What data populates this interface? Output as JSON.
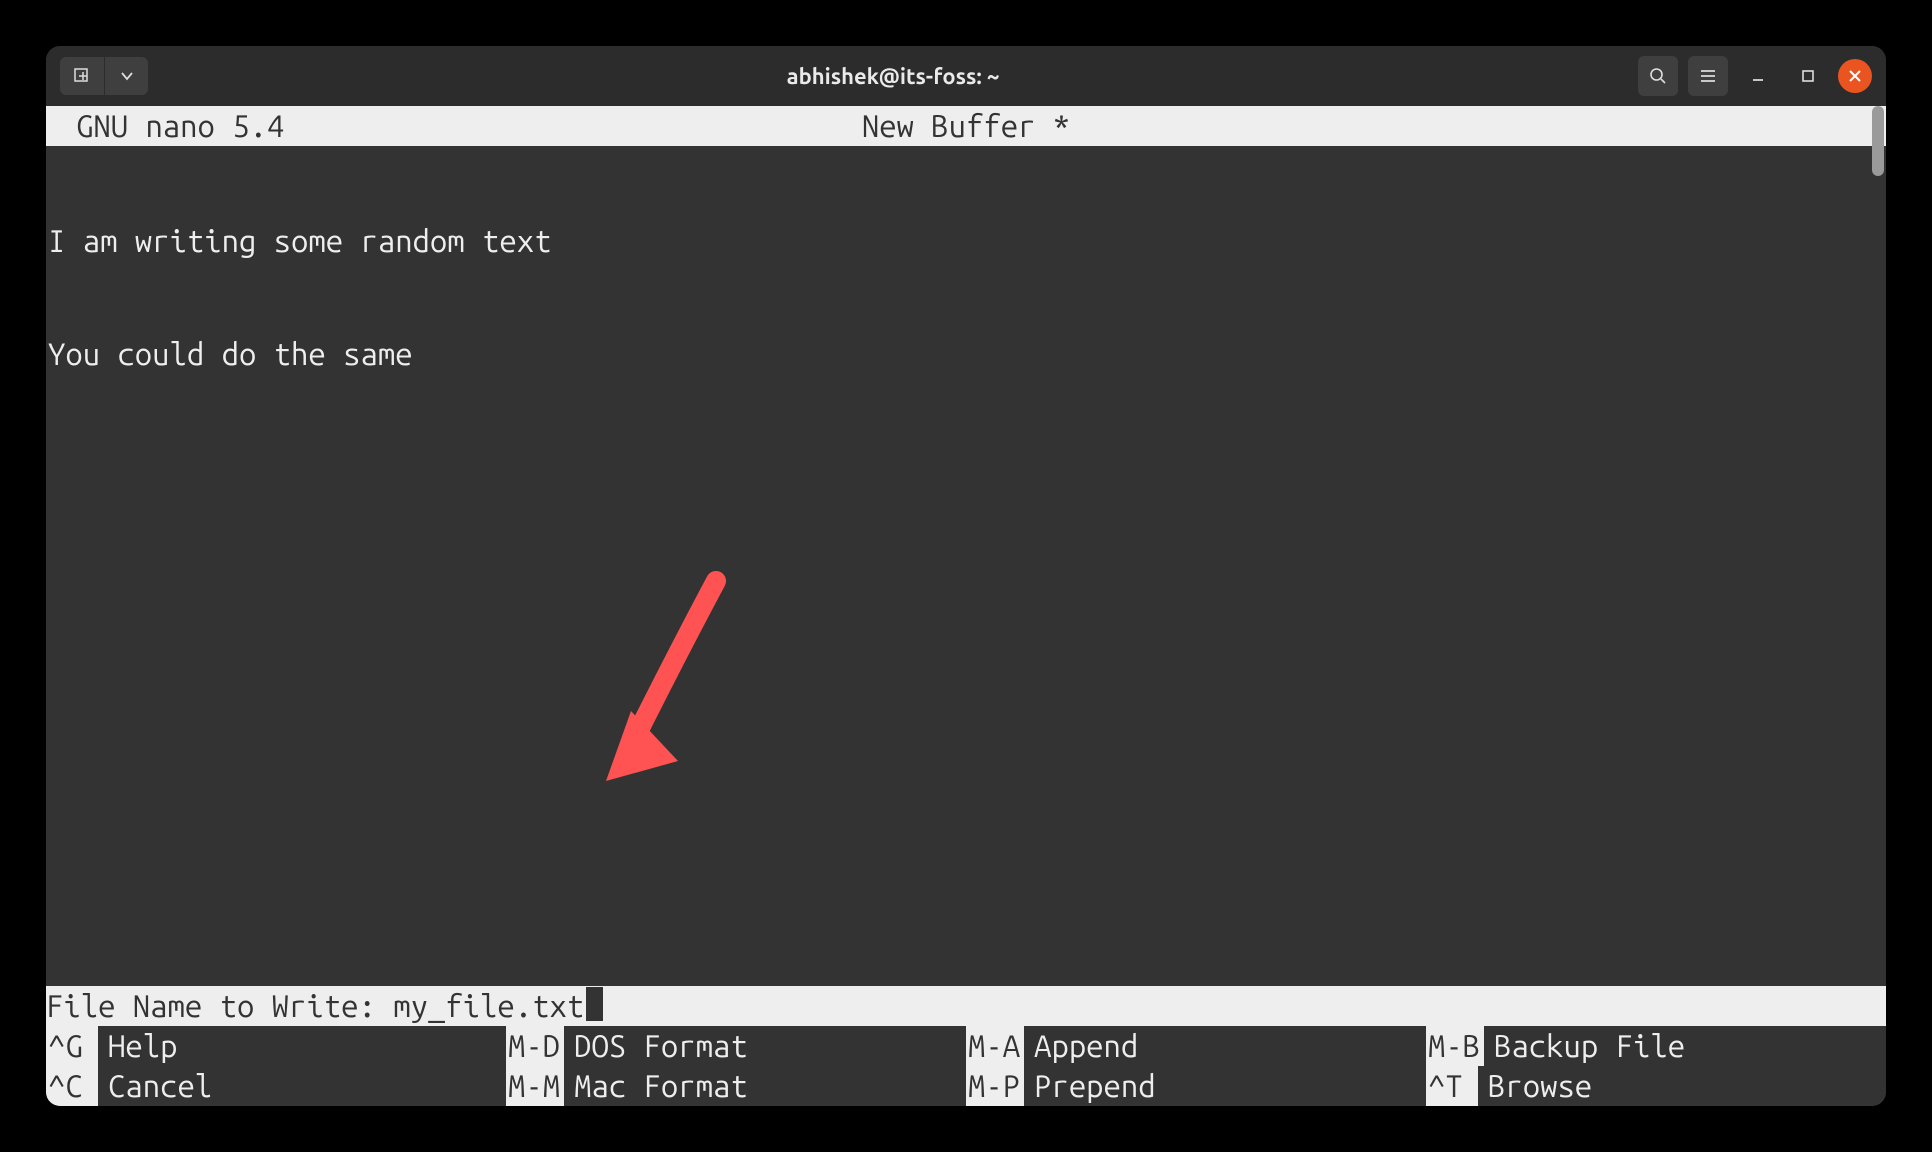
{
  "window": {
    "title": "abhishek@its-foss: ~"
  },
  "nano": {
    "version_label": "GNU nano 5.4",
    "buffer_label": "New Buffer *",
    "lines": [
      "I am writing some random text",
      "You could do the same"
    ],
    "prompt_label": "File Name to Write: ",
    "prompt_value": "my_file.txt",
    "shortcuts": [
      {
        "key": "^G",
        "label": "Help"
      },
      {
        "key": "M-D",
        "label": "DOS Format"
      },
      {
        "key": "M-A",
        "label": "Append"
      },
      {
        "key": "M-B",
        "label": "Backup File"
      },
      {
        "key": "^C",
        "label": "Cancel"
      },
      {
        "key": "M-M",
        "label": "Mac Format"
      },
      {
        "key": "M-P",
        "label": "Prepend"
      },
      {
        "key": "^T",
        "label": "Browse"
      }
    ]
  },
  "colors": {
    "accent": "#e95420",
    "arrow": "#ff5252"
  }
}
